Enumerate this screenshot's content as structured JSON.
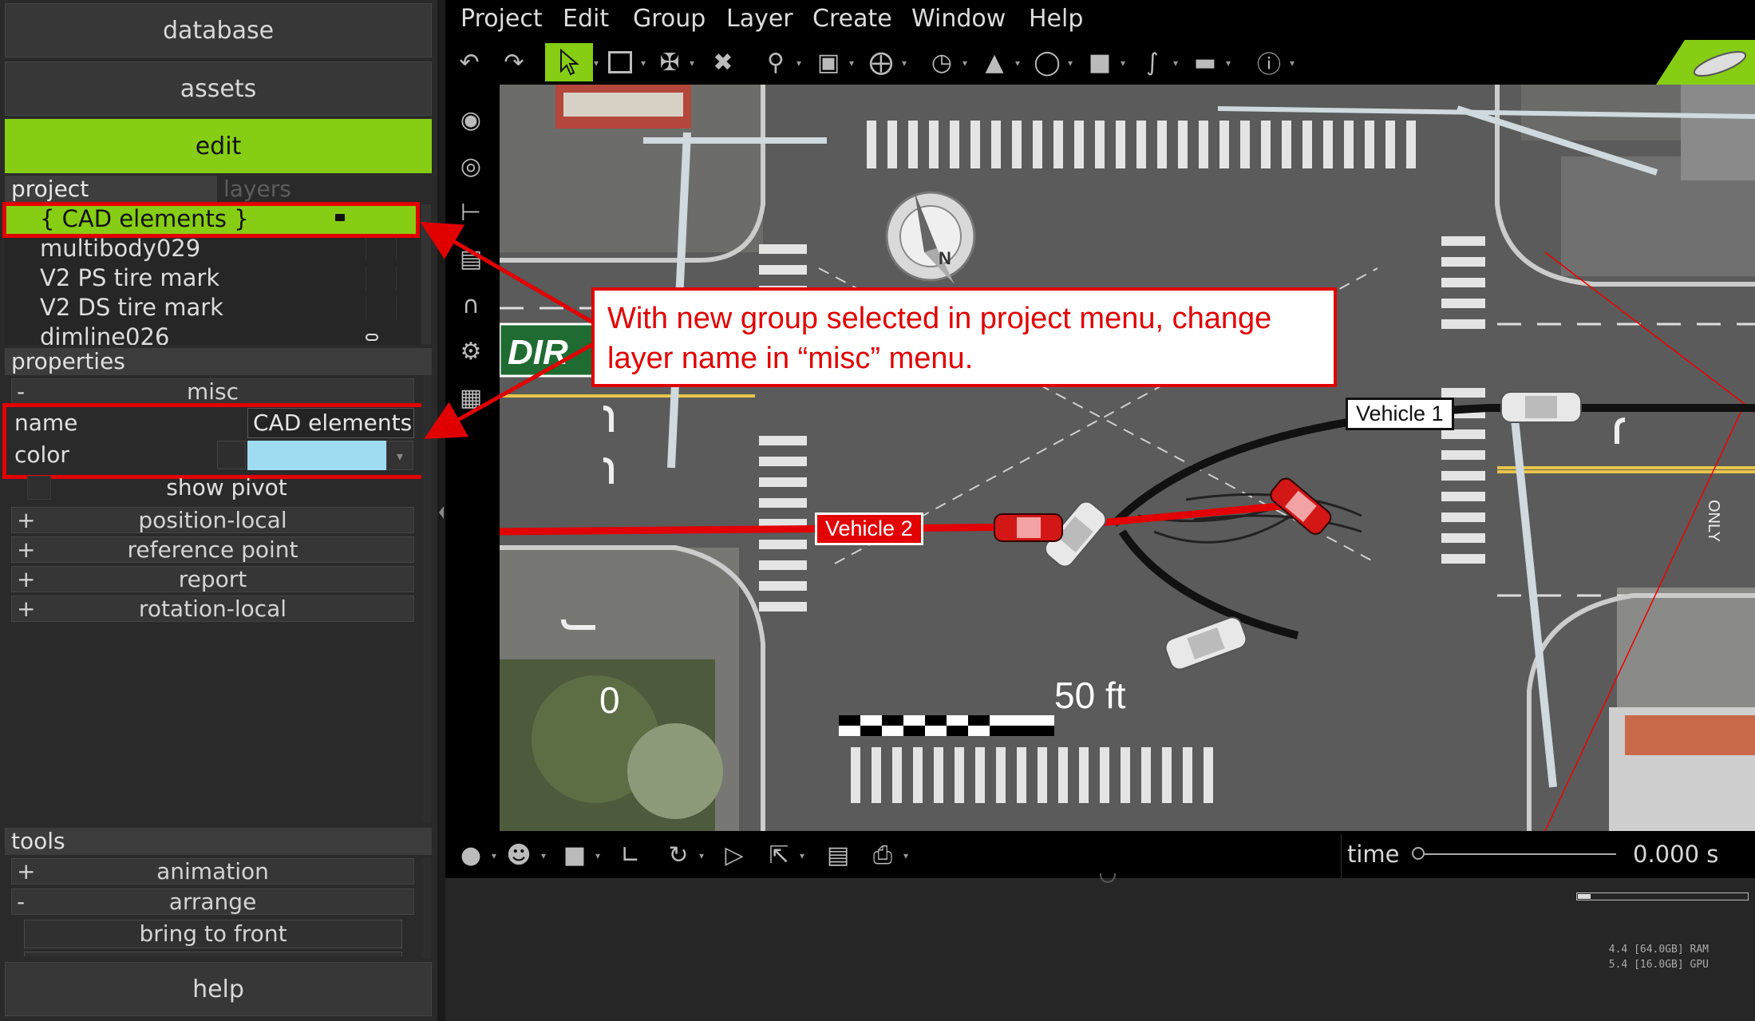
{
  "nav": {
    "database": "database",
    "assets": "assets",
    "edit": "edit",
    "help": "help"
  },
  "project_tabs": {
    "project": "project",
    "layers": "layers"
  },
  "project_items": [
    "{ CAD elements }",
    "multibody029",
    "V2 PS tire mark",
    "V2 DS tire mark",
    "dimline026"
  ],
  "properties": {
    "title": "properties",
    "misc_sign": "-",
    "misc_label": "misc",
    "name_label": "name",
    "name_value": "CAD elements",
    "color_label": "color",
    "color_value": "#9fdcf1",
    "show_pivot": "show pivot",
    "groups": [
      {
        "sign": "+",
        "label": "position-local"
      },
      {
        "sign": "+",
        "label": "reference point"
      },
      {
        "sign": "+",
        "label": "report"
      },
      {
        "sign": "+",
        "label": "rotation-local"
      }
    ]
  },
  "tools": {
    "title": "tools",
    "animation_sign": "+",
    "animation": "animation",
    "arrange_sign": "-",
    "arrange": "arrange",
    "bring_to_front": "bring to front"
  },
  "menu": [
    "Project",
    "Edit",
    "Group",
    "Layer",
    "Create",
    "Window",
    "Help"
  ],
  "timeline": {
    "label": "time",
    "value": "0.000 s"
  },
  "console": {
    "ram": "4.4 [64.0GB] RAM",
    "gpu": "5.4 [16.0GB] GPU"
  },
  "callout": {
    "line1": "With new group selected in project menu, change",
    "line2": "layer name in “misc” menu."
  },
  "scene": {
    "vehicle1": "Vehicle 1",
    "vehicle2": "Vehicle 2",
    "scale_start": "0",
    "scale_end": "50 ft",
    "sign_text": "DIR",
    "compass_letter": "N",
    "road_text": "ONLY"
  },
  "colors": {
    "accent": "#86cd14",
    "annotation": "#e30000"
  }
}
